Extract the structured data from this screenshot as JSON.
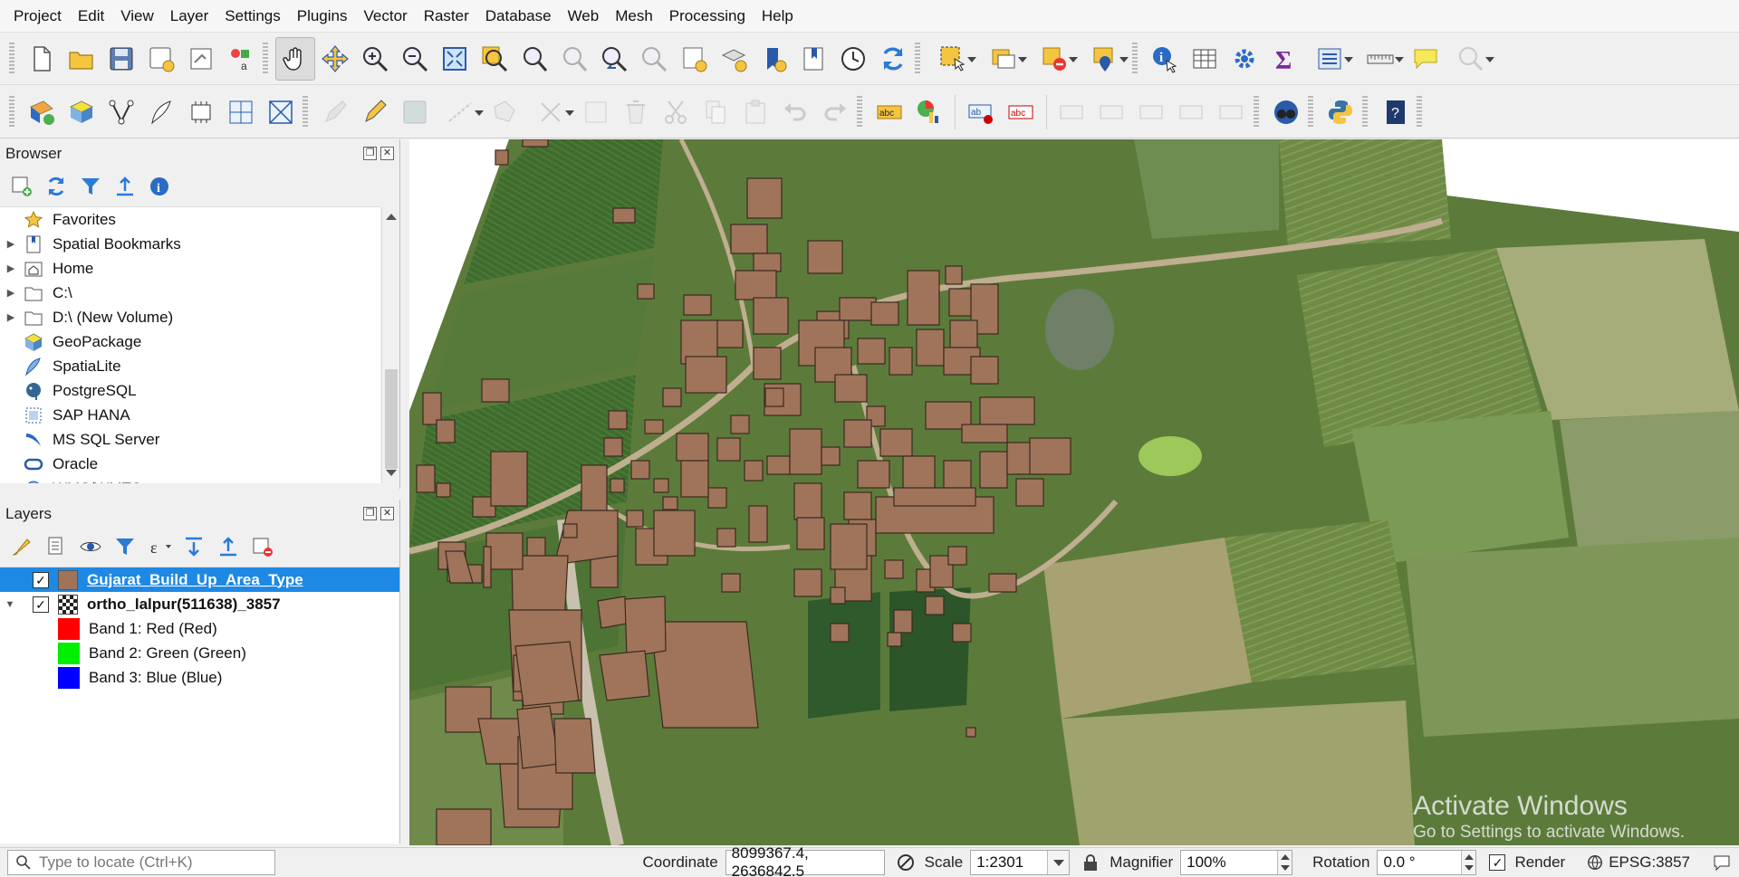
{
  "menu": [
    "Project",
    "Edit",
    "View",
    "Layer",
    "Settings",
    "Plugins",
    "Vector",
    "Raster",
    "Database",
    "Web",
    "Mesh",
    "Processing",
    "Help"
  ],
  "browser": {
    "title": "Browser",
    "items": [
      {
        "label": "Favorites",
        "icon": "star-icon",
        "expandable": false
      },
      {
        "label": "Spatial Bookmarks",
        "icon": "bookmark-icon",
        "expandable": true
      },
      {
        "label": "Home",
        "icon": "home-folder-icon",
        "expandable": true
      },
      {
        "label": "C:\\",
        "icon": "folder-icon",
        "expandable": true
      },
      {
        "label": "D:\\ (New Volume)",
        "icon": "folder-icon",
        "expandable": true
      },
      {
        "label": "GeoPackage",
        "icon": "geopackage-icon",
        "expandable": false
      },
      {
        "label": "SpatiaLite",
        "icon": "spatialite-icon",
        "expandable": false
      },
      {
        "label": "PostgreSQL",
        "icon": "postgresql-icon",
        "expandable": false
      },
      {
        "label": "SAP HANA",
        "icon": "sap-hana-icon",
        "expandable": false
      },
      {
        "label": "MS SQL Server",
        "icon": "mssql-icon",
        "expandable": false
      },
      {
        "label": "Oracle",
        "icon": "oracle-icon",
        "expandable": false
      },
      {
        "label": "WMS/WMTS",
        "icon": "wms-icon",
        "expandable": false
      }
    ]
  },
  "layers": {
    "title": "Layers",
    "items": [
      {
        "label": "Gujarat_Build_Up_Area_Type",
        "checked": true,
        "swatch": "#a0745a",
        "selected": true
      },
      {
        "label": "ortho_lalpur(511638)_3857",
        "checked": true,
        "selected": false
      }
    ],
    "bands": [
      {
        "label": "Band 1: Red (Red)",
        "color": "#ff0000"
      },
      {
        "label": "Band 2: Green (Green)",
        "color": "#00ee00"
      },
      {
        "label": "Band 3: Blue (Blue)",
        "color": "#0000ff"
      }
    ]
  },
  "watermark": {
    "title": "Activate Windows",
    "subtitle": "Go to Settings to activate Windows."
  },
  "status": {
    "locate_placeholder": "Type to locate (Ctrl+K)",
    "coordinate_label": "Coordinate",
    "coordinate_value": "8099367.4, 2636842.5",
    "scale_label": "Scale",
    "scale_value": "1:2301",
    "magnifier_label": "Magnifier",
    "magnifier_value": "100%",
    "rotation_label": "Rotation",
    "rotation_value": "0.0 °",
    "render_label": "Render",
    "crs_label": "EPSG:3857"
  },
  "colors": {
    "building_fill": "#a0745a",
    "selection": "#1e88e5"
  }
}
